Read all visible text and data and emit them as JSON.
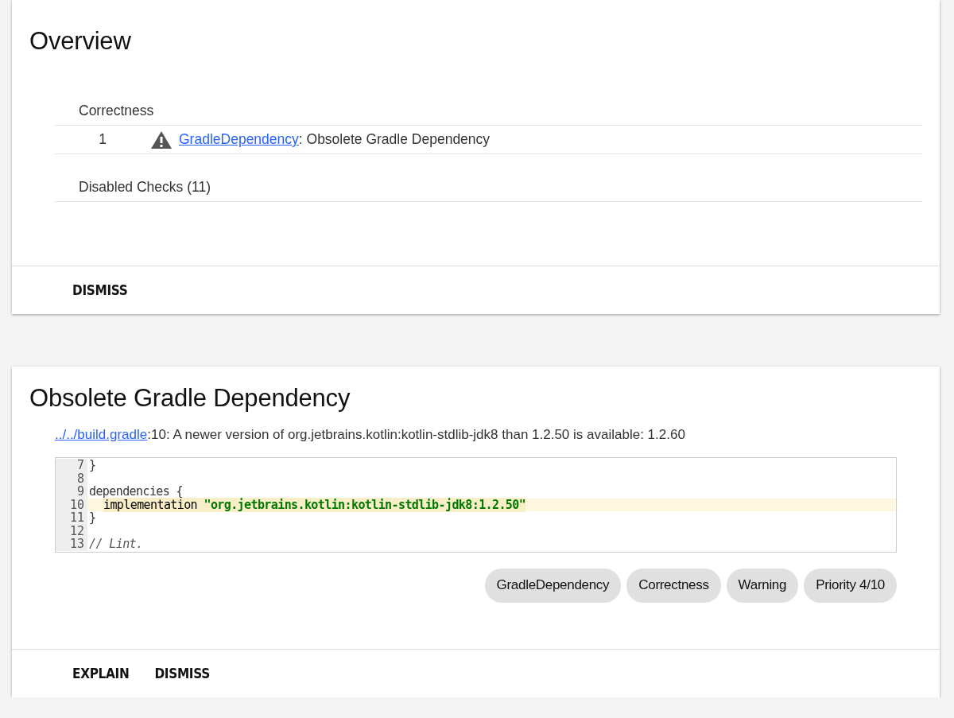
{
  "overview": {
    "title": "Overview",
    "categories": [
      {
        "name": "Correctness",
        "issues": [
          {
            "count": "1",
            "kind": "warning",
            "id": "GradleDependency",
            "separator": ": ",
            "summary": "Obsolete Gradle Dependency"
          }
        ]
      },
      {
        "name": "Disabled Checks (11)"
      }
    ],
    "buttons": [
      "DISMISS"
    ]
  },
  "issue": {
    "title": "Obsolete Gradle Dependency",
    "location": "../../build.gradle",
    "message": ":10: A newer version of org.jetbrains.kotlin:kotlin-stdlib-jdk8 than 1.2.50 is available: 1.2.60",
    "code": [
      {
        "number": "7",
        "highlighted": false,
        "tokens": [
          {
            "kind": "plain",
            "text": "}"
          }
        ]
      },
      {
        "number": "8",
        "highlighted": false
      },
      {
        "number": "9",
        "highlighted": false,
        "tokens": [
          {
            "kind": "plain",
            "text": "dependencies {"
          }
        ]
      },
      {
        "number": "10",
        "highlighted": true,
        "tokens": [
          {
            "kind": "plain",
            "text": "implementation "
          },
          {
            "kind": "string",
            "text": "\"org.jetbrains.kotlin:kotlin-stdlib-jdk8:1.2.50\""
          }
        ]
      },
      {
        "number": "11",
        "highlighted": false,
        "tokens": [
          {
            "kind": "plain",
            "text": "}"
          }
        ]
      },
      {
        "number": "12",
        "highlighted": false
      },
      {
        "number": "13",
        "highlighted": false,
        "tokens": [
          {
            "kind": "comment",
            "text": "// Lint."
          }
        ]
      }
    ],
    "chips": [
      "GradleDependency",
      "Correctness",
      "Warning",
      "Priority 4/10"
    ],
    "buttons": [
      "EXPLAIN",
      "DISMISS"
    ]
  }
}
